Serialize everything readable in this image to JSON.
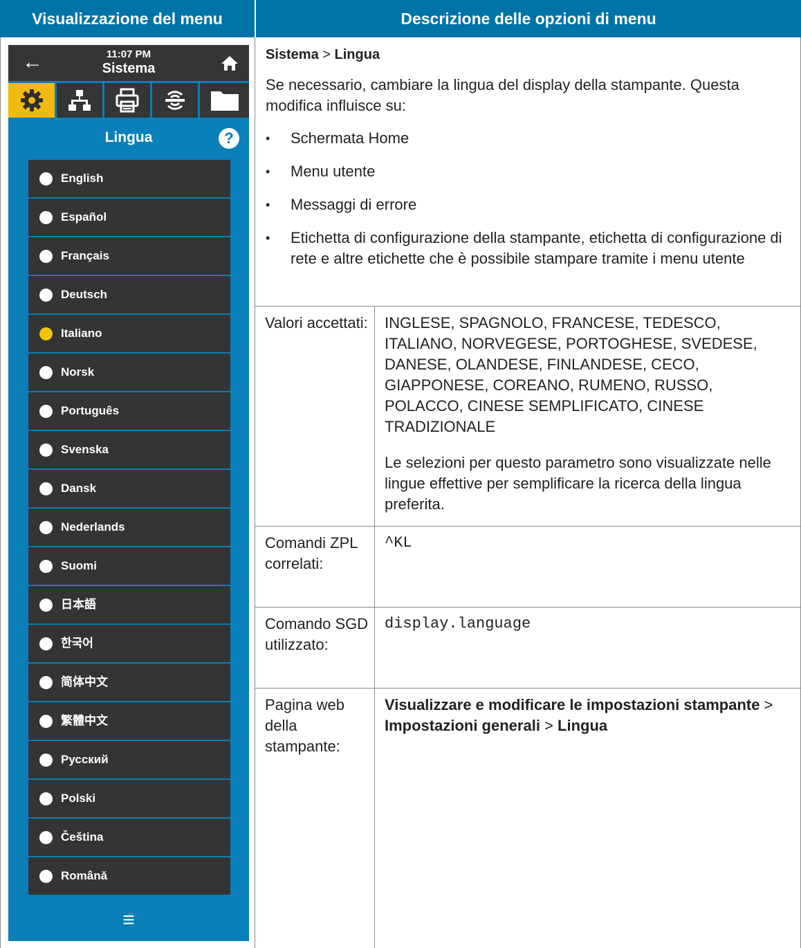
{
  "header": {
    "left": "Visualizzazione del menu",
    "right": "Descrizione delle opzioni di menu"
  },
  "device": {
    "time": "11:07 PM",
    "title": "Sistema",
    "tabs": [
      "settings-icon",
      "network-icon",
      "printer-icon",
      "connectivity-icon",
      "folder-icon"
    ],
    "section_title": "Lingua",
    "help_label": "?",
    "languages": [
      {
        "label": "English",
        "selected": false
      },
      {
        "label": "Español",
        "selected": false
      },
      {
        "label": "Français",
        "selected": false
      },
      {
        "label": "Deutsch",
        "selected": false
      },
      {
        "label": "Italiano",
        "selected": true
      },
      {
        "label": "Norsk",
        "selected": false
      },
      {
        "label": "Português",
        "selected": false
      },
      {
        "label": "Svenska",
        "selected": false
      },
      {
        "label": "Dansk",
        "selected": false
      },
      {
        "label": "Nederlands",
        "selected": false
      },
      {
        "label": "Suomi",
        "selected": false
      },
      {
        "label": "日本語",
        "selected": false
      },
      {
        "label": "한국어",
        "selected": false
      },
      {
        "label": "简体中文",
        "selected": false
      },
      {
        "label": "繁體中文",
        "selected": false
      },
      {
        "label": "Русский",
        "selected": false
      },
      {
        "label": "Polski",
        "selected": false
      },
      {
        "label": "Čeština",
        "selected": false
      },
      {
        "label": "Română",
        "selected": false
      }
    ],
    "accent_color": "#f2b90f",
    "background_color": "#0a7fb8"
  },
  "description": {
    "path_part1": "Sistema",
    "path_sep": " > ",
    "path_part2": "Lingua",
    "intro": "Se necessario, cambiare la lingua del display della stampante. Questa modifica influisce su:",
    "bullets": [
      "Schermata Home",
      "Menu utente",
      "Messaggi di errore",
      "Etichetta di configurazione della stampante, etichetta di configurazione di rete e altre etichette che è possibile stampare tramite i menu utente"
    ]
  },
  "rows": {
    "accepted_label": "Valori accettati:",
    "accepted_values": "INGLESE, SPAGNOLO, FRANCESE, TEDESCO, ITALIANO, NORVEGESE, PORTOGHESE, SVEDESE, DANESE, OLANDESE, FINLANDESE, CECO, GIAPPONESE, COREANO, RUMENO, RUSSO, POLACCO, CINESE SEMPLIFICATO, CINESE TRADIZIONALE",
    "accepted_note": "Le selezioni per questo parametro sono visualizzate nelle lingue effettive per semplificare la ricerca della lingua preferita.",
    "zpl_label": "Comandi ZPL correlati:",
    "zpl_value": "^KL",
    "sgd_label": "Comando SGD utilizzato:",
    "sgd_value": "display.language",
    "web_label": "Pagina web della stampante:",
    "web_part1": "Visualizzare e modificare le impostazioni stampante",
    "web_sep1": " > ",
    "web_part2": "Impostazioni generali",
    "web_sep2": " > ",
    "web_part3": "Lingua"
  }
}
